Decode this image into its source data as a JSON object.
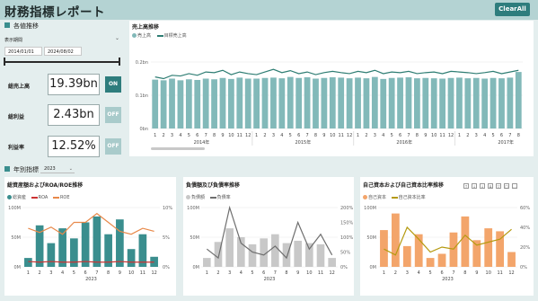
{
  "title": "財務指標レポート",
  "clear_all_label": "ClearAll",
  "filters": {
    "section_label": "各値推移",
    "period_label": "表示期間",
    "start_date": "2014/01/01",
    "end_date": "2024/08/02",
    "year_section_label": "年別指標",
    "year_value": "2023"
  },
  "kpis": [
    {
      "label": "総売上高",
      "value": "19.39bn",
      "toggle": "ON",
      "toggle_on": true
    },
    {
      "label": "総利益",
      "value": "2.43bn",
      "toggle": "OFF",
      "toggle_on": false
    },
    {
      "label": "利益率",
      "value": "12.52%",
      "toggle": "OFF",
      "toggle_on": false
    }
  ],
  "colors": {
    "teal": "#3a8e8e",
    "teal_bar": "#82b9b9",
    "dark_line": "#2e7d73",
    "grey_bar": "#c8c8c8",
    "grey_line": "#6e6e6e",
    "orange": "#f3a56b",
    "olive": "#b59a10",
    "red": "#cc3333",
    "orange_line": "#e8894a"
  },
  "chart_data": [
    {
      "type": "bar",
      "title": "売上高推移",
      "series": [
        {
          "name": "売上高",
          "values": [
            0.147,
            0.145,
            0.15,
            0.145,
            0.148,
            0.146,
            0.15,
            0.148,
            0.152,
            0.149,
            0.153,
            0.15,
            0.15,
            0.152,
            0.153,
            0.151,
            0.155,
            0.152,
            0.154,
            0.15,
            0.152,
            0.154,
            0.153,
            0.151,
            0.153,
            0.151,
            0.155,
            0.149,
            0.152,
            0.153,
            0.154,
            0.151,
            0.152,
            0.151,
            0.15,
            0.152,
            0.153,
            0.151,
            0.152,
            0.15,
            0.152,
            0.151,
            0.153,
            0.17
          ]
        },
        {
          "name": "目標売上高",
          "values": [
            0.155,
            0.15,
            0.16,
            0.158,
            0.165,
            0.16,
            0.17,
            0.168,
            0.175,
            0.162,
            0.17,
            0.165,
            0.162,
            0.17,
            0.178,
            0.168,
            0.174,
            0.165,
            0.17,
            0.162,
            0.168,
            0.172,
            0.168,
            0.165,
            0.172,
            0.168,
            0.175,
            0.165,
            0.17,
            0.168,
            0.172,
            0.165,
            0.168,
            0.17,
            0.165,
            0.172,
            0.17,
            0.168,
            0.165,
            0.168,
            0.172,
            0.165,
            0.17,
            0.175
          ]
        }
      ],
      "x_ticks": [
        "1",
        "2",
        "3",
        "4",
        "5",
        "6",
        "7",
        "8",
        "9",
        "10",
        "11",
        "12",
        "1",
        "2",
        "3",
        "4",
        "5",
        "6",
        "7",
        "8",
        "9",
        "10",
        "11",
        "12",
        "1",
        "2",
        "3",
        "4",
        "5",
        "6",
        "7",
        "8",
        "9",
        "10",
        "11",
        "12",
        "1",
        "2",
        "3",
        "4",
        "5",
        "6",
        "7",
        "8"
      ],
      "year_labels": [
        "2014年",
        "2015年",
        "2016年",
        "2017年"
      ],
      "y_ticks": [
        "0bn",
        "0.1bn",
        "0.2bn"
      ],
      "ylim": [
        0,
        0.2
      ]
    },
    {
      "type": "bar",
      "title": "総資産額およびROA/ROE推移",
      "legend": [
        "総資産",
        "ROA",
        "ROE"
      ],
      "categories": [
        "1",
        "2",
        "3",
        "4",
        "5",
        "6",
        "7",
        "8",
        "9",
        "10",
        "11",
        "12"
      ],
      "xlabel": "2023",
      "series": [
        {
          "name": "総資産",
          "values": [
            15,
            70,
            40,
            65,
            48,
            75,
            85,
            55,
            80,
            30,
            55,
            17
          ]
        },
        {
          "name": "ROA",
          "values": [
            0.9,
            0.8,
            0.9,
            0.8,
            0.8,
            0.9,
            0.8,
            0.8,
            0.9,
            0.8,
            0.8,
            0.8
          ]
        },
        {
          "name": "ROE",
          "values": [
            6.5,
            5.8,
            6.7,
            5.5,
            7.5,
            7.5,
            9.0,
            7.5,
            6.0,
            5.5,
            6.5,
            6.0
          ]
        }
      ],
      "y_left_ticks": [
        "0M",
        "50M",
        "100M"
      ],
      "y_right_ticks": [
        "0%",
        "5%",
        "10%"
      ],
      "ylim_left": [
        0,
        100
      ],
      "ylim_right": [
        0,
        10
      ]
    },
    {
      "type": "bar",
      "title": "負債額及び負債率推移",
      "legend": [
        "負債額",
        "負債率"
      ],
      "categories": [
        "1",
        "2",
        "3",
        "4",
        "5",
        "6",
        "7",
        "8",
        "9",
        "10",
        "11",
        "12"
      ],
      "xlabel": "2023",
      "series": [
        {
          "name": "負債額",
          "values": [
            15,
            42,
            65,
            50,
            38,
            48,
            55,
            40,
            44,
            40,
            38,
            15
          ]
        },
        {
          "name": "負債率",
          "values": [
            60,
            30,
            200,
            80,
            50,
            40,
            70,
            30,
            150,
            60,
            110,
            40
          ]
        }
      ],
      "y_left_ticks": [
        "0M",
        "50M",
        "100M"
      ],
      "y_right_ticks": [
        "0%",
        "50%",
        "100%",
        "150%",
        "200%"
      ],
      "ylim_left": [
        0,
        100
      ],
      "ylim_right": [
        0,
        200
      ]
    },
    {
      "type": "bar",
      "title": "自己資本および自己資本比率推移",
      "legend": [
        "自己資本",
        "自己資本比率"
      ],
      "categories": [
        "1",
        "2",
        "3",
        "4",
        "5",
        "6",
        "7",
        "8",
        "9",
        "10",
        "11",
        "12"
      ],
      "xlabel": "2023",
      "series": [
        {
          "name": "自己資本",
          "values": [
            62,
            90,
            35,
            55,
            15,
            22,
            58,
            85,
            45,
            65,
            60,
            25
          ]
        },
        {
          "name": "自己資本比率",
          "values": [
            18,
            12,
            40,
            28,
            15,
            20,
            18,
            32,
            22,
            25,
            28,
            38
          ]
        }
      ],
      "y_left_ticks": [
        "0M",
        "50M",
        "100M"
      ],
      "y_right_ticks": [
        "0%",
        "20%",
        "40%",
        "60%"
      ],
      "ylim_left": [
        0,
        100
      ],
      "ylim_right": [
        0,
        60
      ]
    }
  ]
}
